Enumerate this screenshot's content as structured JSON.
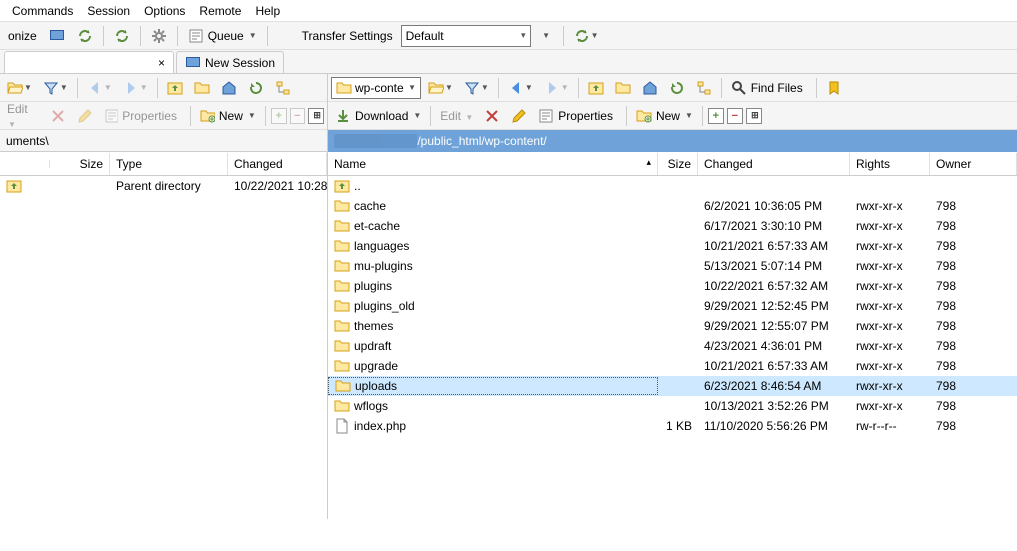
{
  "menu": {
    "items": [
      "Commands",
      "Session",
      "Options",
      "Remote",
      "Help"
    ]
  },
  "toolbar1": {
    "sync": "onize",
    "queue_label": "Queue",
    "transfer_label": "Transfer Settings",
    "transfer_value": "Default"
  },
  "tabs": {
    "close": "×",
    "new_session": "New Session"
  },
  "dir_remote": "wp-conte",
  "find_files": "Find Files",
  "cmd": {
    "edit": "Edit",
    "properties": "Properties",
    "new": "New",
    "download": "Download"
  },
  "path_left": "uments\\",
  "path_right": "/public_html/wp-content/",
  "headers_left": {
    "name": "",
    "size": "Size",
    "type": "Type",
    "changed": "Changed"
  },
  "headers_right": {
    "name": "Name",
    "size": "Size",
    "changed": "Changed",
    "rights": "Rights",
    "owner": "Owner"
  },
  "left_rows": [
    {
      "name": "",
      "type": "Parent directory",
      "changed": "10/22/2021 10:28"
    }
  ],
  "right_rows": [
    {
      "icon": "up",
      "name": "..",
      "size": "",
      "changed": "",
      "rights": "",
      "owner": ""
    },
    {
      "icon": "folder",
      "name": "cache",
      "size": "",
      "changed": "6/2/2021 10:36:05 PM",
      "rights": "rwxr-xr-x",
      "owner": "798"
    },
    {
      "icon": "folder",
      "name": "et-cache",
      "size": "",
      "changed": "6/17/2021 3:30:10 PM",
      "rights": "rwxr-xr-x",
      "owner": "798"
    },
    {
      "icon": "folder",
      "name": "languages",
      "size": "",
      "changed": "10/21/2021 6:57:33 AM",
      "rights": "rwxr-xr-x",
      "owner": "798"
    },
    {
      "icon": "folder",
      "name": "mu-plugins",
      "size": "",
      "changed": "5/13/2021 5:07:14 PM",
      "rights": "rwxr-xr-x",
      "owner": "798"
    },
    {
      "icon": "folder",
      "name": "plugins",
      "size": "",
      "changed": "10/22/2021 6:57:32 AM",
      "rights": "rwxr-xr-x",
      "owner": "798"
    },
    {
      "icon": "folder",
      "name": "plugins_old",
      "size": "",
      "changed": "9/29/2021 12:52:45 PM",
      "rights": "rwxr-xr-x",
      "owner": "798"
    },
    {
      "icon": "folder",
      "name": "themes",
      "size": "",
      "changed": "9/29/2021 12:55:07 PM",
      "rights": "rwxr-xr-x",
      "owner": "798"
    },
    {
      "icon": "folder",
      "name": "updraft",
      "size": "",
      "changed": "4/23/2021 4:36:01 PM",
      "rights": "rwxr-xr-x",
      "owner": "798"
    },
    {
      "icon": "folder",
      "name": "upgrade",
      "size": "",
      "changed": "10/21/2021 6:57:33 AM",
      "rights": "rwxr-xr-x",
      "owner": "798"
    },
    {
      "icon": "folder",
      "name": "uploads",
      "size": "",
      "changed": "6/23/2021 8:46:54 AM",
      "rights": "rwxr-xr-x",
      "owner": "798",
      "selected": true
    },
    {
      "icon": "folder",
      "name": "wflogs",
      "size": "",
      "changed": "10/13/2021 3:52:26 PM",
      "rights": "rwxr-xr-x",
      "owner": "798"
    },
    {
      "icon": "file",
      "name": "index.php",
      "size": "1 KB",
      "changed": "11/10/2020 5:56:26 PM",
      "rights": "rw-r--r--",
      "owner": "798"
    }
  ]
}
